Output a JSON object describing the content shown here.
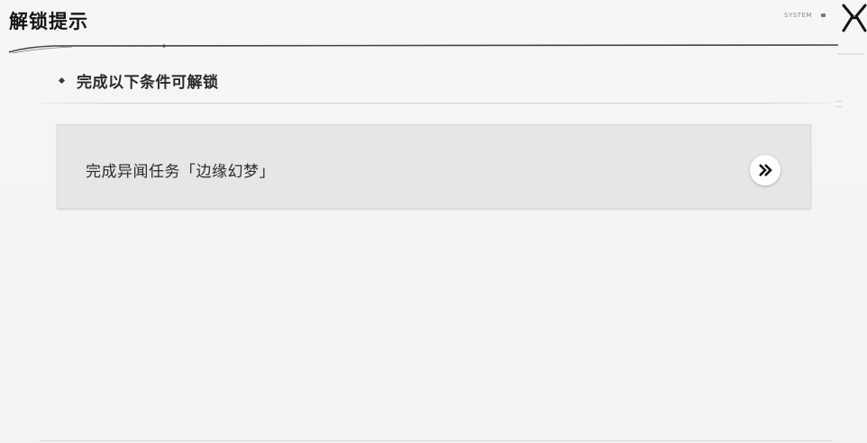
{
  "window": {
    "title": "解锁提示",
    "header_deco_text": "SYSTEM"
  },
  "section": {
    "subtitle": "完成以下条件可解锁"
  },
  "conditions": [
    {
      "label": "完成异闻任务「边缘幻梦」",
      "action_icon": "double-chevron-right-icon"
    }
  ],
  "colors": {
    "background": "#f4f4f4",
    "card": "#e6e6e6",
    "text": "#1e1e1e"
  }
}
